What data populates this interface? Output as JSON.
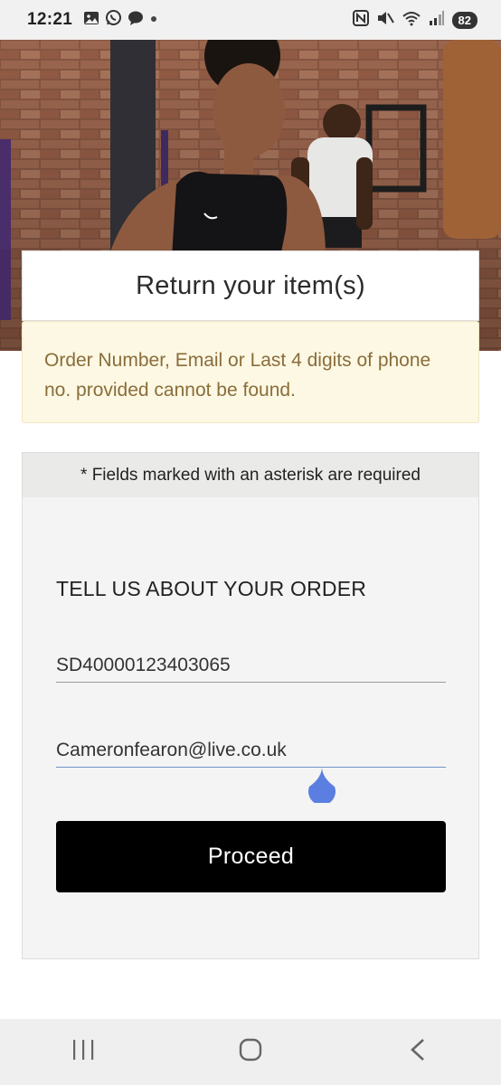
{
  "status_bar": {
    "time": "12:21",
    "left_icons": [
      "gallery-icon",
      "whatsapp-icon",
      "chat-bubble-icon",
      "notification-dot-icon"
    ],
    "right_icons": [
      "nfc-icon",
      "mute-icon",
      "wifi-icon",
      "signal-icon"
    ],
    "battery": "82"
  },
  "hero": {
    "image_description": "Gym scene with athletes in front of brick wall"
  },
  "page": {
    "title": "Return your item(s)"
  },
  "error": {
    "message": "Order Number, Email or Last 4 digits of phone no. provided cannot be found."
  },
  "form": {
    "required_note": "* Fields marked with an asterisk are required",
    "heading": "TELL US ABOUT YOUR ORDER",
    "order_number_value": "SD40000123403065",
    "email_value": "Cameronfearon@live.co.uk",
    "proceed_label": "Proceed"
  },
  "nav_bar": {
    "buttons": [
      "recent-apps-icon",
      "home-icon",
      "back-icon"
    ]
  },
  "colors": {
    "error_bg": "#fcf8e3",
    "error_text": "#8a6d3b",
    "button_bg": "#000000",
    "panel_bg": "#f4f4f4",
    "cursor_handle": "#5b7fe0"
  }
}
